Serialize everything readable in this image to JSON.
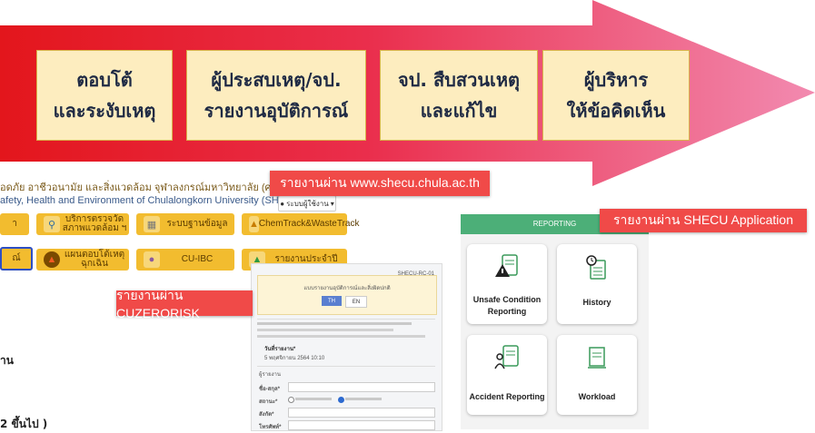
{
  "steps": [
    {
      "label": "ตอบโต้\nและระงับเหตุ"
    },
    {
      "label": "ผู้ประสบเหตุ/จป.\nรายงานอุบัติการณ์"
    },
    {
      "label": "จป. สืบสวนเหตุ\nและแก้ไข"
    },
    {
      "label": "ผู้บริหาร\nให้ข้อคิดเห็น"
    }
  ],
  "channels": {
    "website": "รายงานผ่าน www.shecu.chula.ac.th",
    "app": "รายงานผ่าน SHECU Application",
    "cuzerorisk": "รายงานผ่าน CUZERORISK"
  },
  "website": {
    "header_th": "อดภัย อาชีวอนามัย และสิ่งแวดล้อม จุฬาลงกรณ์มหาวิทยาลัย (ศปอส.)",
    "header_en": "afety, Health and Environment of Chulalongkorn University (SHECU)",
    "login": "ระบบผู้ใช้งาน",
    "buttons_row1": [
      "า",
      "บริการตรวจวัด\nสภาพแวดล้อม ฯ",
      "ระบบฐานข้อมูล",
      "ChemTrack&WasteTrack"
    ],
    "buttons_row2": [
      "ณ์",
      "แผนตอบโต้เหตุฉุกเฉิน",
      "CU-IBC",
      "รายงานประจำปี"
    ]
  },
  "form": {
    "code": "SHECU-RC-01",
    "title": "แบบรายงานอุบัติการณ์และสิ่งผิดปกติ",
    "lang_th": "TH",
    "lang_en": "EN",
    "date_label": "วันที่รายงาน*",
    "date_value": "5 พฤศจิกายน 2564 10:10",
    "section": "ผู้รายงาน",
    "fields": [
      "ชื่อ-สกุล*",
      "สถานะ*",
      "สังกัด*",
      "โทรศัพท์*"
    ]
  },
  "app": {
    "header": "REPORTING",
    "header_color": "#4caf78",
    "cards": [
      {
        "label": "Unsafe Condition\nReporting",
        "icon": "warning-clipboard-icon"
      },
      {
        "label": "History",
        "icon": "history-document-icon"
      },
      {
        "label": "Accident Reporting",
        "icon": "accident-clipboard-icon"
      },
      {
        "label": "Workload",
        "icon": "stacked-papers-icon"
      }
    ]
  },
  "left_text": {
    "line1": "าน",
    "line2": "2 ขึ้นไป )"
  }
}
